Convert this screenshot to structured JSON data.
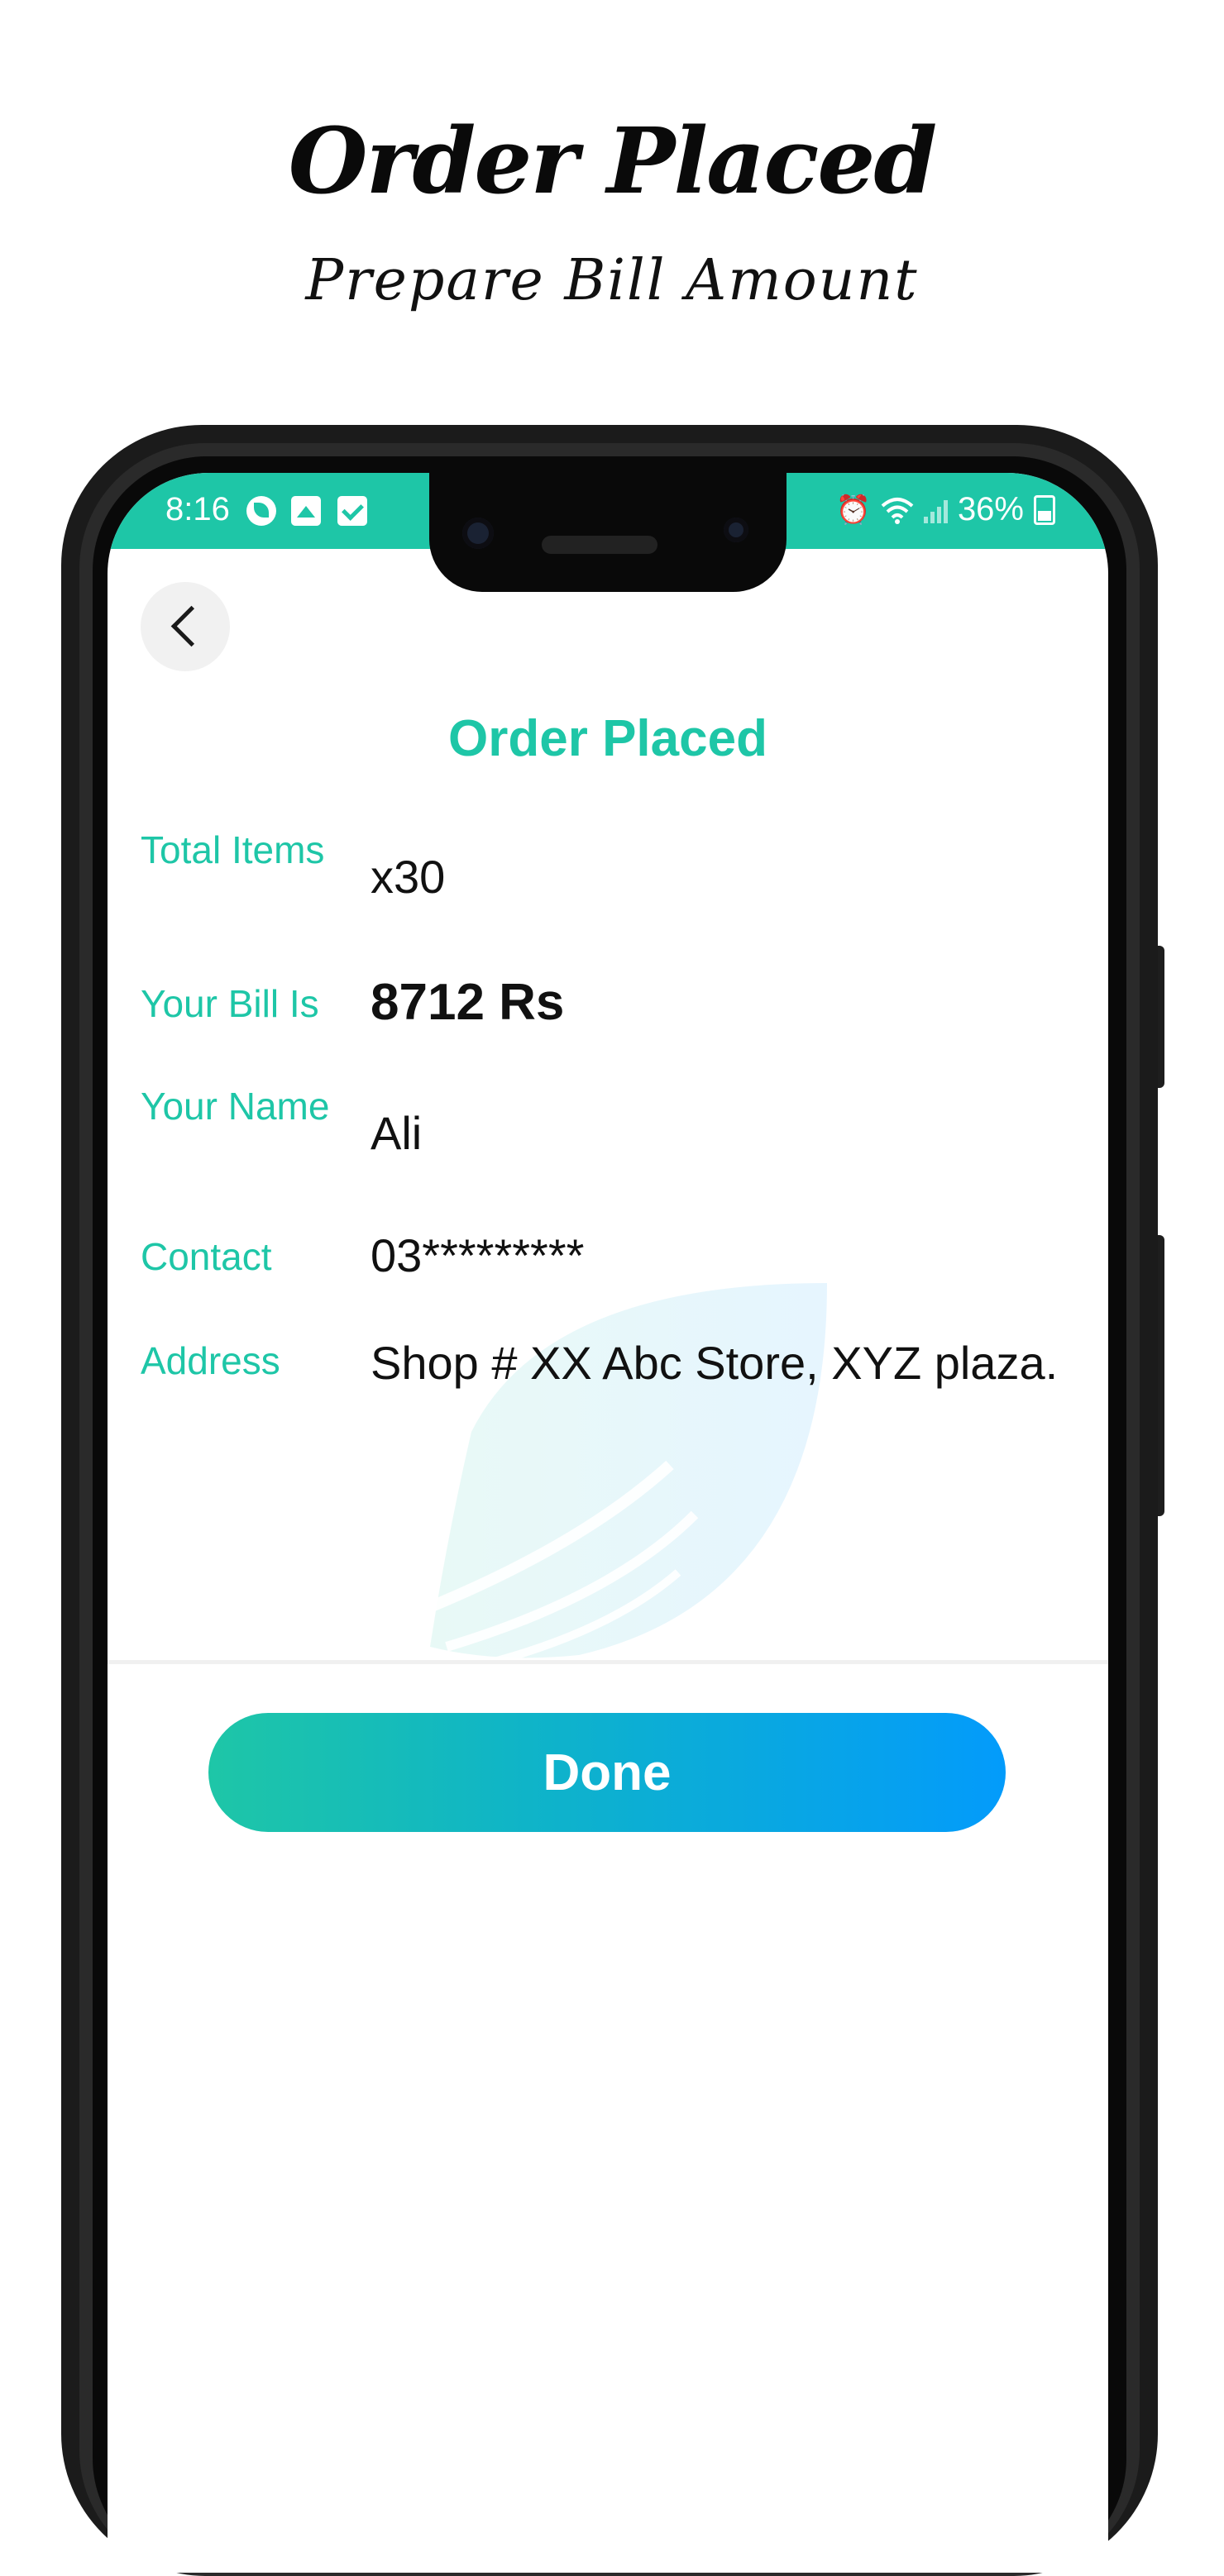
{
  "promo": {
    "title": "Order Placed",
    "subtitle": "Prepare Bill Amount"
  },
  "statusbar": {
    "time": "8:16",
    "battery": "36%",
    "icons": [
      "leaf-app-icon",
      "gallery-icon",
      "task-check-icon",
      "alarm-icon",
      "wifi-icon",
      "signal-icon",
      "battery-icon"
    ]
  },
  "screen": {
    "title": "Order Placed",
    "back_icon": "chevron-left-icon"
  },
  "details": {
    "total_items": {
      "label": "Total Items",
      "value": "x30"
    },
    "bill": {
      "label": "Your Bill Is",
      "value": "8712 Rs"
    },
    "name": {
      "label": "Your Name",
      "value": "Ali"
    },
    "contact": {
      "label": "Contact",
      "value": "03*********"
    },
    "address": {
      "label": "Address",
      "value": "Shop # XX Abc Store, XYZ plaza."
    }
  },
  "actions": {
    "done_label": "Done"
  },
  "colors": {
    "accent": "#1ec6a7",
    "gradient_start": "#1ec6a7",
    "gradient_end": "#039bfb",
    "text": "#111111"
  }
}
